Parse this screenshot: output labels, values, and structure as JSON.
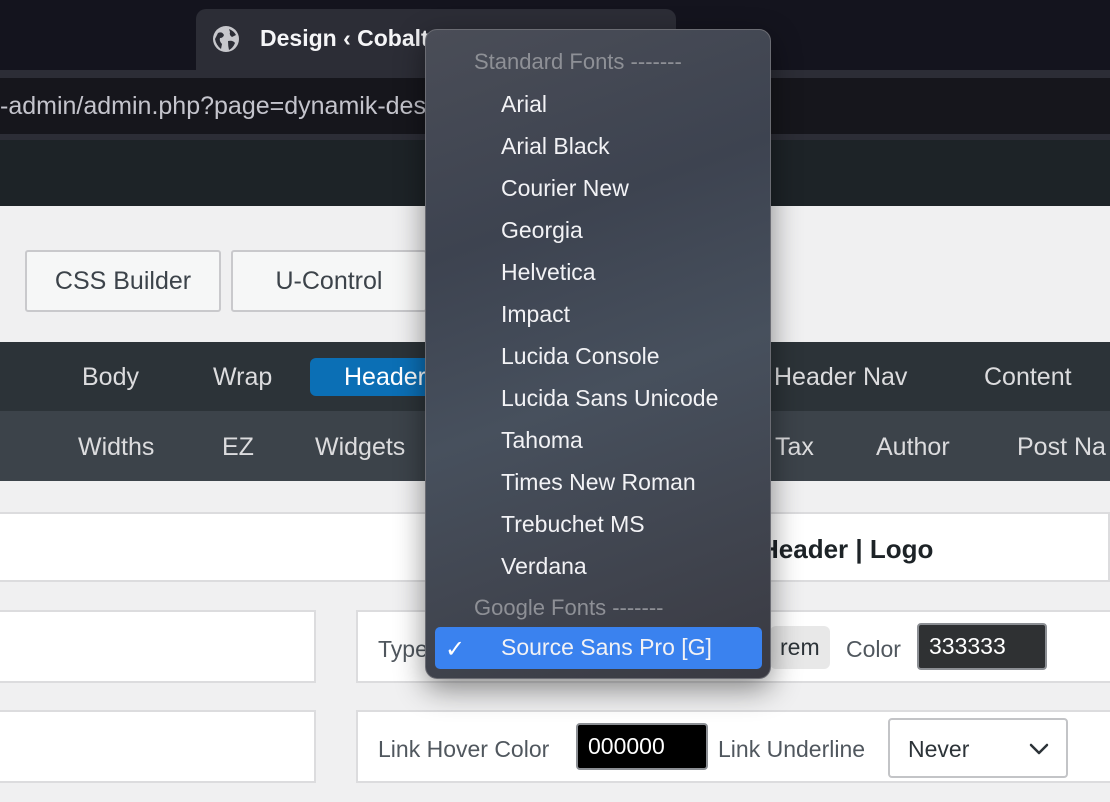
{
  "browser": {
    "tab_title": "Design ‹ Cobalt",
    "url": "-admin/admin.php?page=dynamik-design"
  },
  "toolbar": {
    "css_builder": "CSS Builder",
    "u_control": "U-Control"
  },
  "nav_primary": [
    "Body",
    "Wrap",
    "Header",
    "Header Nav",
    "Content"
  ],
  "nav_secondary": [
    "Widths",
    "EZ",
    "Widgets",
    "Tax",
    "Author",
    "Post Na"
  ],
  "section": {
    "title": "Header | Logo"
  },
  "typography_row": {
    "type_label": "Type",
    "unit": "rem",
    "color_label": "Color",
    "color_value": "333333"
  },
  "link_row": {
    "hover_label": "Link Hover Color",
    "hover_value": "000000",
    "underline_label": "Link Underline",
    "underline_value": "Never"
  },
  "font_menu": {
    "standard_header": "Standard Fonts -------",
    "standard_fonts": [
      "Arial",
      "Arial Black",
      "Courier New",
      "Georgia",
      "Helvetica",
      "Impact",
      "Lucida Console",
      "Lucida Sans Unicode",
      "Tahoma",
      "Times New Roman",
      "Trebuchet MS",
      "Verdana"
    ],
    "google_header": "Google Fonts -------",
    "selected": "Source Sans Pro [G]"
  },
  "colors": {
    "accent": "#0b6fb5",
    "menu_selection": "#3a82ef",
    "nav_bg": "#2c3338"
  }
}
